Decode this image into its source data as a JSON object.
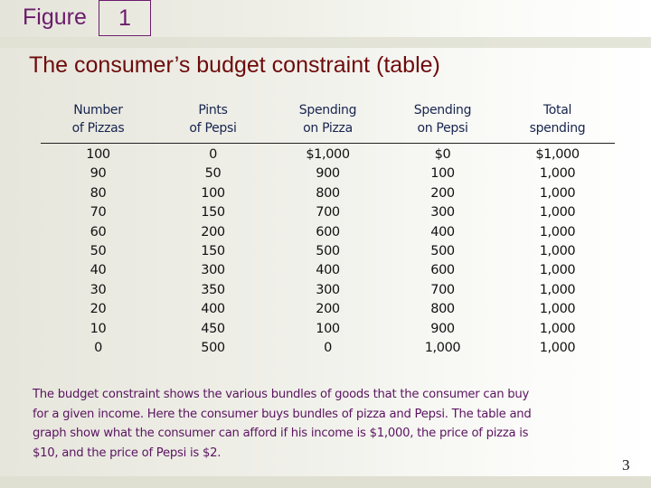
{
  "slide": {
    "figure_label": "Figure",
    "figure_number": "1",
    "title": "The consumer’s budget constraint (table)",
    "page_number": "3",
    "colors": {
      "figure_label": "#6b1b6b",
      "title": "#6e0b0b",
      "table_header": "#17244e",
      "caption": "#5b1460"
    }
  },
  "table": {
    "headers": [
      [
        "Number",
        "of Pizzas"
      ],
      [
        "Pints",
        "of Pepsi"
      ],
      [
        "Spending",
        "on Pizza"
      ],
      [
        "Spending",
        "on Pepsi"
      ],
      [
        "Total",
        "spending"
      ]
    ],
    "rows": [
      [
        "100",
        "0",
        "$1,000",
        "$0",
        "$1,000"
      ],
      [
        "90",
        "50",
        "900",
        "100",
        "1,000"
      ],
      [
        "80",
        "100",
        "800",
        "200",
        "1,000"
      ],
      [
        "70",
        "150",
        "700",
        "300",
        "1,000"
      ],
      [
        "60",
        "200",
        "600",
        "400",
        "1,000"
      ],
      [
        "50",
        "150",
        "500",
        "500",
        "1,000"
      ],
      [
        "40",
        "300",
        "400",
        "600",
        "1,000"
      ],
      [
        "30",
        "350",
        "300",
        "700",
        "1,000"
      ],
      [
        "20",
        "400",
        "200",
        "800",
        "1,000"
      ],
      [
        "10",
        "450",
        "100",
        "900",
        "1,000"
      ],
      [
        "0",
        "500",
        "0",
        "1,000",
        "1,000"
      ]
    ]
  },
  "caption": {
    "lines": [
      "The budget constraint shows the various bundles of goods that the consumer can buy",
      "for a given income. Here the consumer buys bundles of pizza and Pepsi. The table and",
      "graph show what the consumer can afford if his income is $1,000, the price of pizza is",
      "$10, and the price of Pepsi is $2."
    ]
  }
}
